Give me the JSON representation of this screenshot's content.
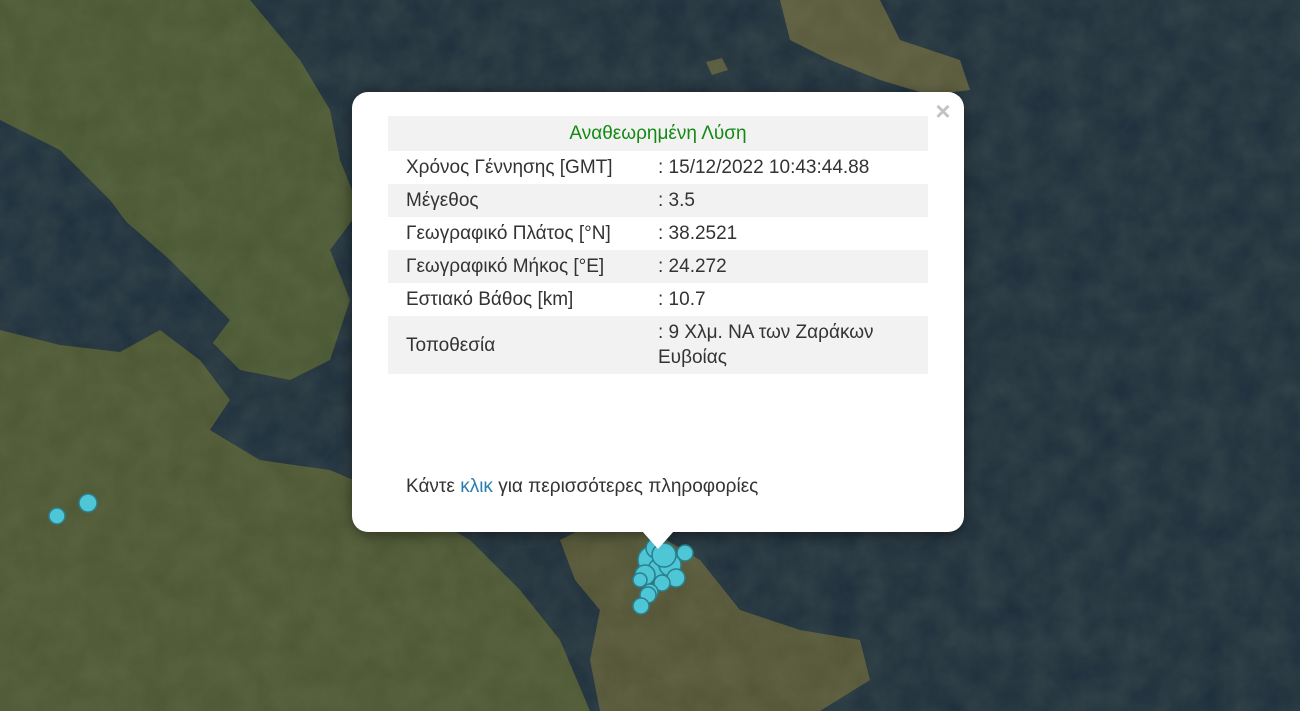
{
  "map": {
    "land_color": "#4e5634",
    "sea_color": "#1d2d3b",
    "marker_color": "#4ec6d6",
    "marker_stroke": "#2a7f8c"
  },
  "popup": {
    "close_label": "×",
    "header": "Αναθεωρημένη Λύση",
    "header_color": "#148a14",
    "rows": [
      {
        "label": "Χρόνος Γέννησης [GMT]",
        "value": ": 15/12/2022 10:43:44.88"
      },
      {
        "label": "Μέγεθος",
        "value": ": 3.5"
      },
      {
        "label": "Γεωγραφικό Πλάτος [°N]",
        "value": ": 38.2521"
      },
      {
        "label": "Γεωγραφικό Μήκος [°E]",
        "value": ": 24.272"
      },
      {
        "label": "Εστιακό Βάθος [km]",
        "value": ": 10.7"
      },
      {
        "label": "Τοποθεσία",
        "value": ": 9 Χλμ. ΝΑ των Ζαράκων Ευβοίας"
      }
    ],
    "more_prefix": "Κάντε ",
    "more_link": "κλικ",
    "more_suffix": " για περισσότερες πληροφορίες",
    "link_color": "#2a7db3"
  }
}
